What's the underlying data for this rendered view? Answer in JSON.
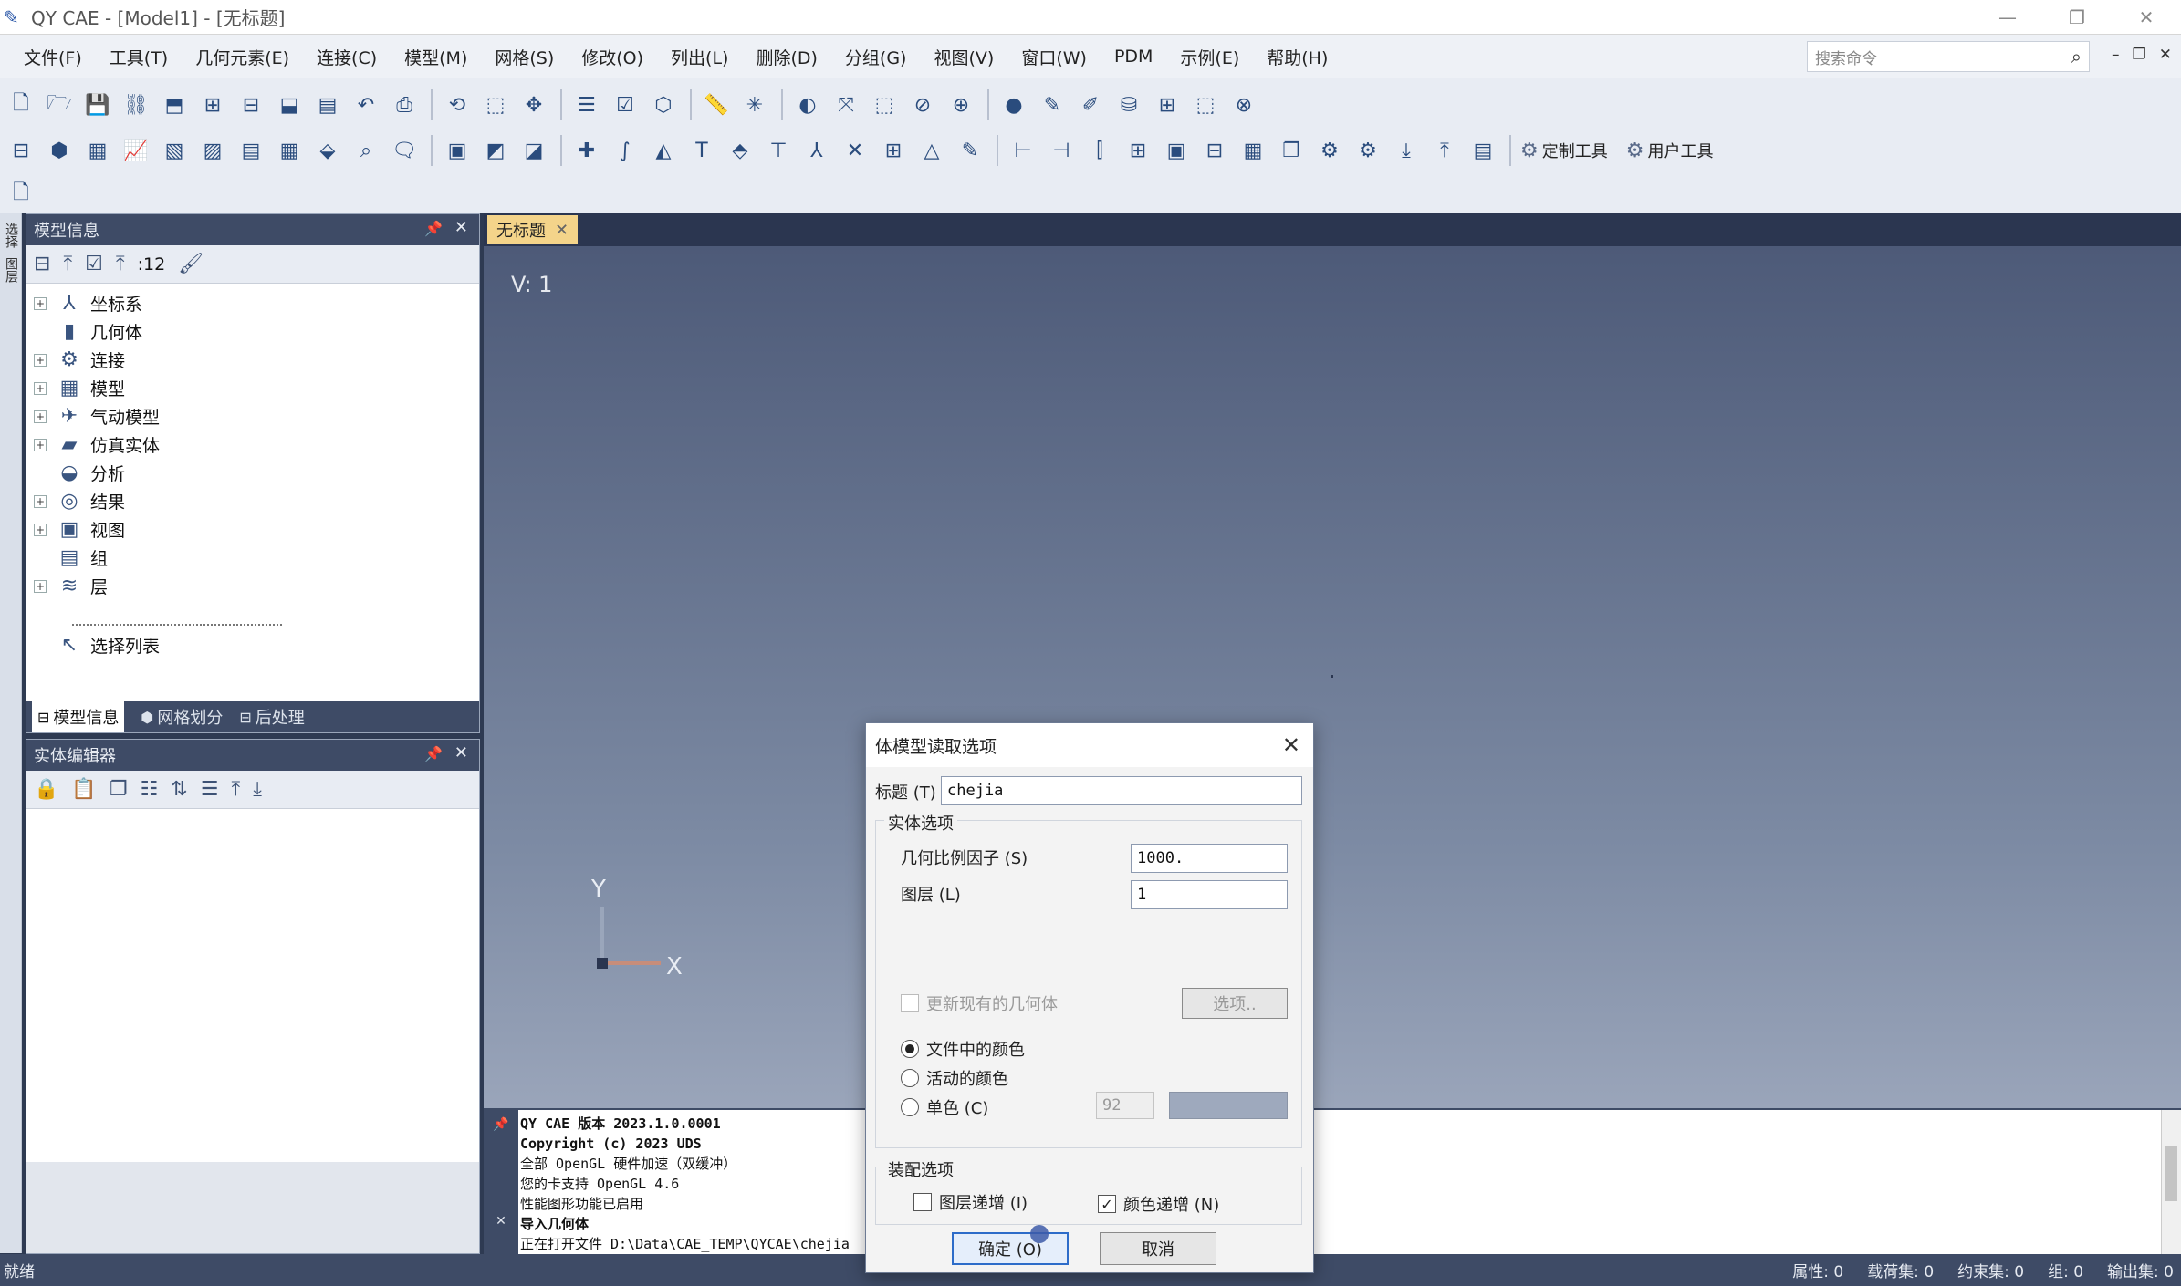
{
  "window": {
    "title": "QY CAE - [Model1] - [无标题]",
    "controls": [
      "—",
      "❐",
      "✕"
    ]
  },
  "menu": {
    "items": [
      "文件(F)",
      "工具(T)",
      "几何元素(E)",
      "连接(C)",
      "模型(M)",
      "网格(S)",
      "修改(O)",
      "列出(L)",
      "删除(D)",
      "分组(G)",
      "视图(V)",
      "窗口(W)",
      "PDM",
      "示例(E)",
      "帮助(H)"
    ],
    "search_placeholder": "搜索命令",
    "mdi_controls": [
      "–",
      "❐",
      "✕"
    ]
  },
  "toolbar": {
    "layer_count": ":12",
    "custom_tools": "定制工具",
    "user_tools": "用户工具"
  },
  "dock_strip": {
    "items": [
      "选择",
      "图层"
    ]
  },
  "model_panel": {
    "title": "模型信息",
    "tree": [
      {
        "label": "坐标系",
        "icon": "coordinate-icon",
        "glyph": "⅄",
        "expandable": true
      },
      {
        "label": "几何体",
        "icon": "geometry-icon",
        "glyph": "▮",
        "expandable": false
      },
      {
        "label": "连接",
        "icon": "connection-icon",
        "glyph": "⚙",
        "expandable": true
      },
      {
        "label": "模型",
        "icon": "model-icon",
        "glyph": "▦",
        "expandable": true
      },
      {
        "label": "气动模型",
        "icon": "aero-model-icon",
        "glyph": "✈",
        "expandable": true
      },
      {
        "label": "仿真实体",
        "icon": "simulation-entity-icon",
        "glyph": "▰",
        "expandable": true
      },
      {
        "label": "分析",
        "icon": "analysis-icon",
        "glyph": "◒",
        "expandable": false
      },
      {
        "label": "结果",
        "icon": "result-icon",
        "glyph": "◎",
        "expandable": true
      },
      {
        "label": "视图",
        "icon": "view-icon",
        "glyph": "▣",
        "expandable": true
      },
      {
        "label": "组",
        "icon": "group-icon",
        "glyph": "▤",
        "expandable": false
      },
      {
        "label": "层",
        "icon": "layer-icon",
        "glyph": "≋",
        "expandable": true
      }
    ],
    "selection_list": "选择列表",
    "tabs": [
      "模型信息",
      "网格划分",
      "后处理"
    ]
  },
  "entity_panel": {
    "title": "实体编辑器"
  },
  "document": {
    "tab": "无标题",
    "view_label": "V: 1",
    "axis_y": "Y",
    "axis_x": "X"
  },
  "output": {
    "lines": [
      "QY CAE 版本 2023.1.0.0001",
      "Copyright (c) 2023 UDS",
      "全部 OpenGL 硬件加速（双缓冲）",
      "您的卡支持 OpenGL 4.6",
      "性能图形功能已启用",
      "导入几何体",
      "正在打开文件 D:\\Data\\CAE_TEMP\\QYCAE\\chejia"
    ]
  },
  "status": {
    "left": "就绪",
    "right": [
      "属性: 0",
      "载荷集: 0",
      "约束集: 0",
      "组: 0",
      "输出集: 0"
    ]
  },
  "dialog": {
    "title": "体模型读取选项",
    "title_label": "标题 (T)",
    "title_value": "chejia",
    "entity_options": "实体选项",
    "scale_label": "几何比例因子 (S)",
    "scale_value": "1000.",
    "layer_label": "图层 (L)",
    "layer_value": "1",
    "update_existing": "更新现有的几何体",
    "options_button": "选项..",
    "color_from_file": "文件中的颜色",
    "active_color": "活动的颜色",
    "single_color": "单色 (C)",
    "single_color_value": "92",
    "assembly_options": "装配选项",
    "layer_increment": "图层递增 (I)",
    "color_increment": "颜色递增 (N)",
    "ok": "确定 (O)",
    "cancel": "取消"
  }
}
